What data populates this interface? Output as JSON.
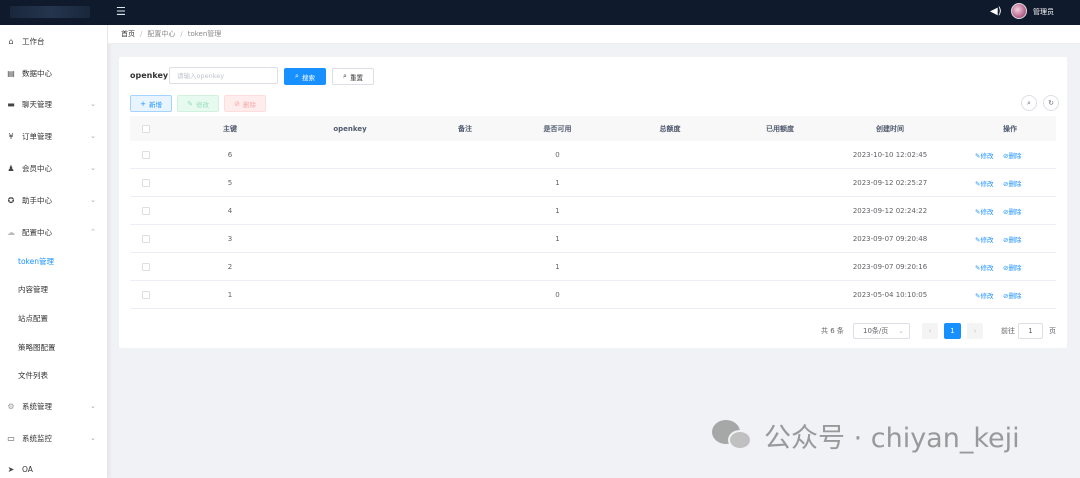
{
  "header": {
    "menu_toggle_icon": "menu-fold-icon",
    "speaker_icon": "speaker-icon",
    "username": "管理员"
  },
  "sidebar": {
    "items": [
      {
        "label": "工作台",
        "icon": "dashboard-icon"
      },
      {
        "label": "数据中心",
        "icon": "data-icon"
      },
      {
        "label": "聊天管理",
        "icon": "chat-icon"
      },
      {
        "label": "订单管理",
        "icon": "yen-icon"
      },
      {
        "label": "会员中心",
        "icon": "users-icon"
      },
      {
        "label": "助手中心",
        "icon": "assistant-icon"
      },
      {
        "label": "配置中心",
        "icon": "config-icon"
      },
      {
        "label": "系统管理",
        "icon": "gear-icon"
      },
      {
        "label": "系统监控",
        "icon": "monitor-icon"
      },
      {
        "label": "OA",
        "icon": "send-icon"
      }
    ],
    "config_children": [
      "token管理",
      "内容管理",
      "站点配置",
      "策略图配置",
      "文件列表"
    ]
  },
  "breadcrumb": [
    "首页",
    "配置中心",
    "token管理"
  ],
  "search": {
    "label": "openkey",
    "placeholder": "请输入openkey",
    "search_button": "搜索",
    "reset_button": "重置"
  },
  "toolbar": {
    "add": "新增",
    "edit": "修改",
    "delete": "删除"
  },
  "table": {
    "columns": [
      "主键",
      "openkey",
      "备注",
      "是否可用",
      "总额度",
      "已用额度",
      "创建时间",
      "操作"
    ],
    "rows": [
      {
        "id": "6",
        "openkey": "",
        "remark": "",
        "enabled": "0",
        "total": "",
        "used": "",
        "created": "2023-10-10 12:02:45"
      },
      {
        "id": "5",
        "openkey": "",
        "remark": "",
        "enabled": "1",
        "total": "",
        "used": "",
        "created": "2023-09-12 02:25:27"
      },
      {
        "id": "4",
        "openkey": "",
        "remark": "",
        "enabled": "1",
        "total": "",
        "used": "",
        "created": "2023-09-12 02:24:22"
      },
      {
        "id": "3",
        "openkey": "",
        "remark": "",
        "enabled": "1",
        "total": "",
        "used": "",
        "created": "2023-09-07 09:20:48"
      },
      {
        "id": "2",
        "openkey": "",
        "remark": "",
        "enabled": "1",
        "total": "",
        "used": "",
        "created": "2023-09-07 09:20:16"
      },
      {
        "id": "1",
        "openkey": "",
        "remark": "",
        "enabled": "0",
        "total": "",
        "used": "",
        "created": "2023-05-04 10:10:05"
      }
    ],
    "action_edit": "修改",
    "action_delete": "删除"
  },
  "pagination": {
    "total": "共 6 条",
    "page_size": "10条/页",
    "current_page": "1",
    "goto_label": "前往",
    "goto_value": "1",
    "page_suffix": "页"
  },
  "watermark": "公众号 · chiyan_keji",
  "colors": {
    "primary": "#1890ff",
    "topbar": "#0f1b2d",
    "success_light": "#e7faf0",
    "danger_light": "#ffeded"
  }
}
